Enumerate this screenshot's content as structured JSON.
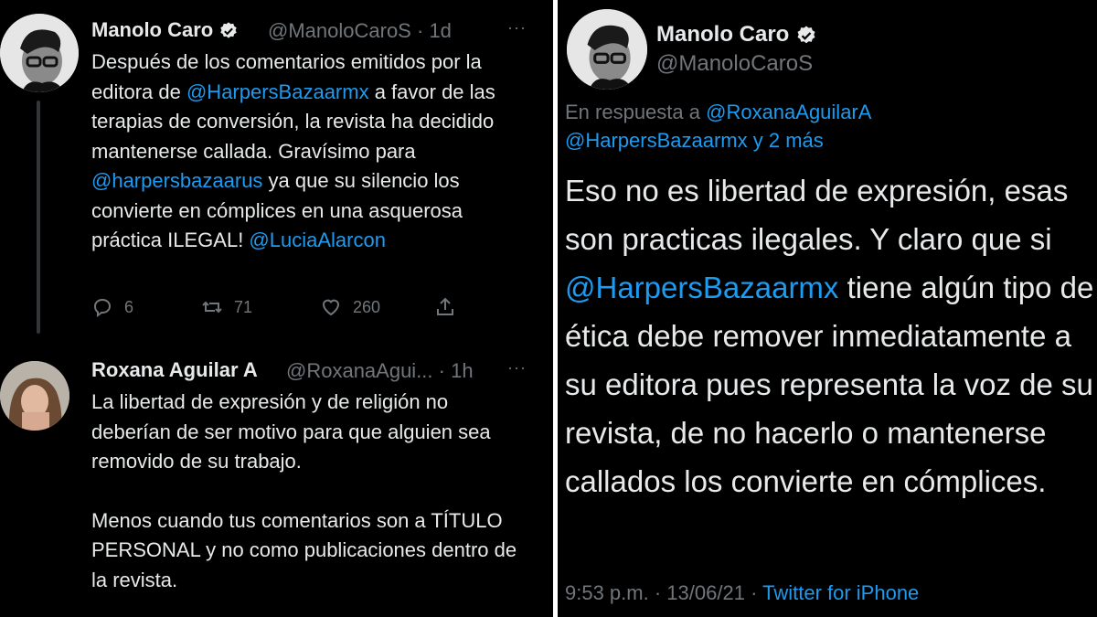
{
  "left": {
    "tweet1": {
      "name": "Manolo Caro",
      "handle": "@ManoloCaroS",
      "separator": "·",
      "time": "1d",
      "more": "···",
      "text": [
        {
          "t": "Después de los comentarios emitidos por la editora de "
        },
        {
          "t": "@HarpersBazaarmx",
          "mention": true
        },
        {
          "t": " a favor de las terapias de conversión, la revista ha decidido mantenerse callada. Gravísimo para "
        },
        {
          "t": "@harpersbazaarus",
          "mention": true
        },
        {
          "t": " ya que su silencio los convierte en cómplices en una asquerosa práctica ILEGAL! "
        },
        {
          "t": "@LuciaAlarcon",
          "mention": true
        }
      ],
      "actions": {
        "replies": "6",
        "retweets": "71",
        "likes": "260"
      }
    },
    "tweet2": {
      "name": "Roxana Aguilar A",
      "handle": "@RoxanaAgui...",
      "separator": "·",
      "time": "1h",
      "more": "···",
      "paragraph1": "La libertad de expresión y de religión no deberían de ser motivo para que alguien sea removido de su trabajo.",
      "paragraph2": "Menos cuando tus comentarios son a TÍTULO PERSONAL y no como publicaciones dentro de la revista."
    }
  },
  "right": {
    "name": "Manolo Caro",
    "handle": "@ManoloCaroS",
    "more": "···",
    "replying_prefix": "En respuesta a ",
    "replying_to_1": "@RoxanaAguilarA",
    "replying_to_2": "@HarpersBazaarmx",
    "replying_suffix": " y 2 más",
    "text": [
      {
        "t": "Eso no es libertad de expresión, esas son practicas ilegales. Y claro que si "
      },
      {
        "t": "@HarpersBazaarmx",
        "mention": true
      },
      {
        "t": " tiene algún tipo de ética debe remover inmediatamente a su editora pues representa la voz de su revista, de no hacerlo o mantenerse callados los convierte en cómplices."
      }
    ],
    "time": "9:53 p.m.",
    "dot": "·",
    "date": "13/06/21",
    "source": "Twitter for iPhone"
  },
  "colors": {
    "background": "#000000",
    "text": "#e7e9ea",
    "secondary": "#71767b",
    "accent": "#1d9bf0"
  },
  "icons": [
    "verified-badge-icon",
    "reply-icon",
    "retweet-icon",
    "like-icon",
    "share-icon",
    "more-options-icon"
  ]
}
